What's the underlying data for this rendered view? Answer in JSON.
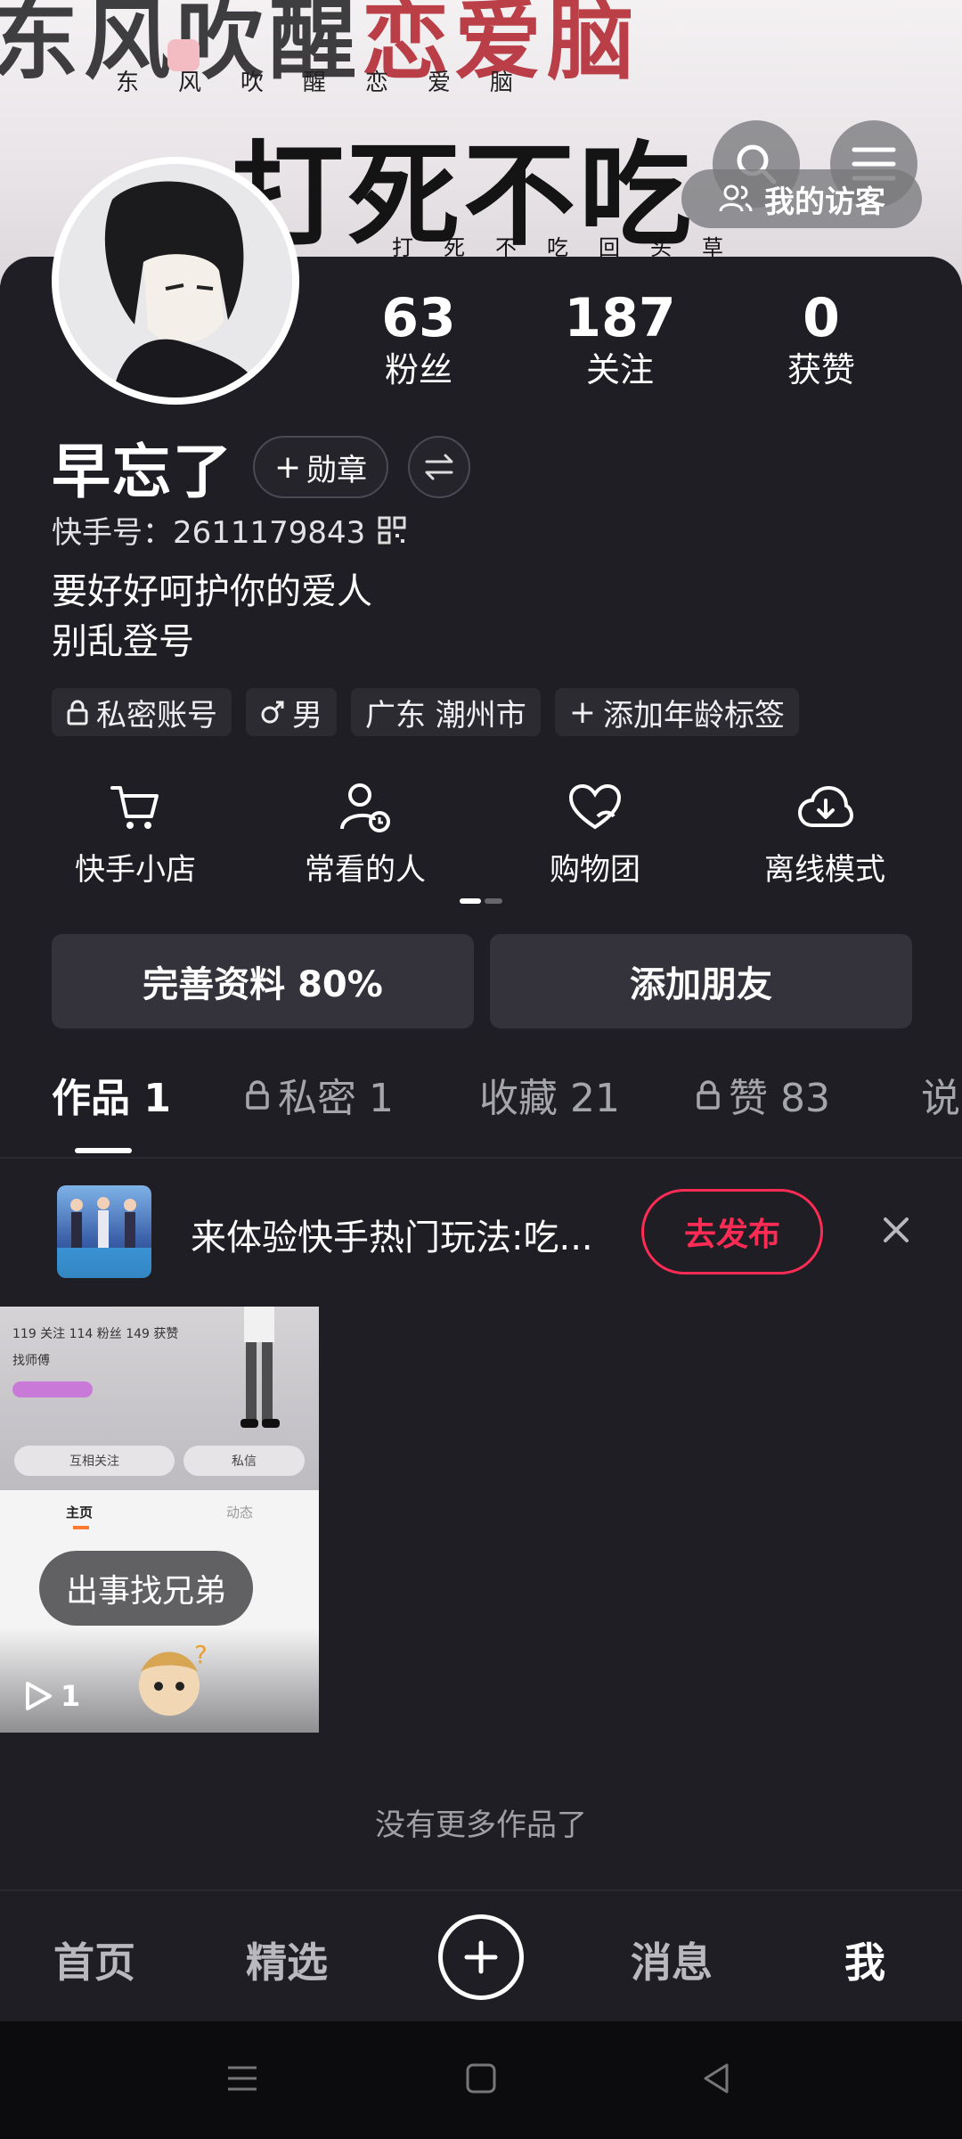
{
  "banner": {
    "line1_black": "东风吹醒",
    "line1_red": "恋爱脑",
    "sub1": "东风吹醒恋爱脑",
    "line2": "打死不吃",
    "sub2": "打死不吃回头草",
    "visitor_label": "我的访客"
  },
  "stats": [
    {
      "num": "63",
      "label": "粉丝"
    },
    {
      "num": "187",
      "label": "关注"
    },
    {
      "num": "0",
      "label": "获赞"
    }
  ],
  "profile": {
    "name": "早忘了",
    "badge_button": "勋章",
    "kuaishou_id": "快手号：2611179843",
    "bio_line1": "要好好呵护你的爱人",
    "bio_line2": "别乱登号"
  },
  "tags": [
    {
      "label": "私密账号",
      "icon": "lock-icon"
    },
    {
      "label": "男",
      "icon": "male-icon"
    },
    {
      "label": "广东 潮州市",
      "icon": ""
    },
    {
      "label": "添加年龄标签",
      "icon": "plus-icon"
    }
  ],
  "shortcuts": [
    {
      "label": "快手小店",
      "icon": "cart-icon"
    },
    {
      "label": "常看的人",
      "icon": "person-clock-icon"
    },
    {
      "label": "购物团",
      "icon": "heart-group-icon"
    },
    {
      "label": "离线模式",
      "icon": "cloud-download-icon"
    }
  ],
  "actions": {
    "complete_profile": "完善资料 80%",
    "add_friend": "添加朋友"
  },
  "tabs": [
    {
      "label": "作品 1",
      "locked": false,
      "active": true
    },
    {
      "label": "私密 1",
      "locked": true,
      "active": false
    },
    {
      "label": "收藏 21",
      "locked": false,
      "active": false
    },
    {
      "label": "赞 83",
      "locked": true,
      "active": false
    },
    {
      "label": "说",
      "locked": false,
      "active": false
    }
  ],
  "promo": {
    "text": "来体验快手热门玩法:吃...",
    "button": "去发布"
  },
  "video": {
    "caption": "出事找兄弟",
    "play_count": "1",
    "inner_stats": "119 关注  114 粉丝  149 获赞",
    "inner_name": "找师傅",
    "inner_btn1": "互相关注",
    "inner_btn2": "私信",
    "inner_tab1": "主页",
    "inner_tab2": "动态"
  },
  "no_more": "没有更多作品了",
  "bottom_nav": {
    "home": "首页",
    "featured": "精选",
    "messages": "消息",
    "me": "我"
  },
  "colors": {
    "background": "#1f1e24",
    "accent": "#fe2c55",
    "button_bg": "#34333b"
  }
}
